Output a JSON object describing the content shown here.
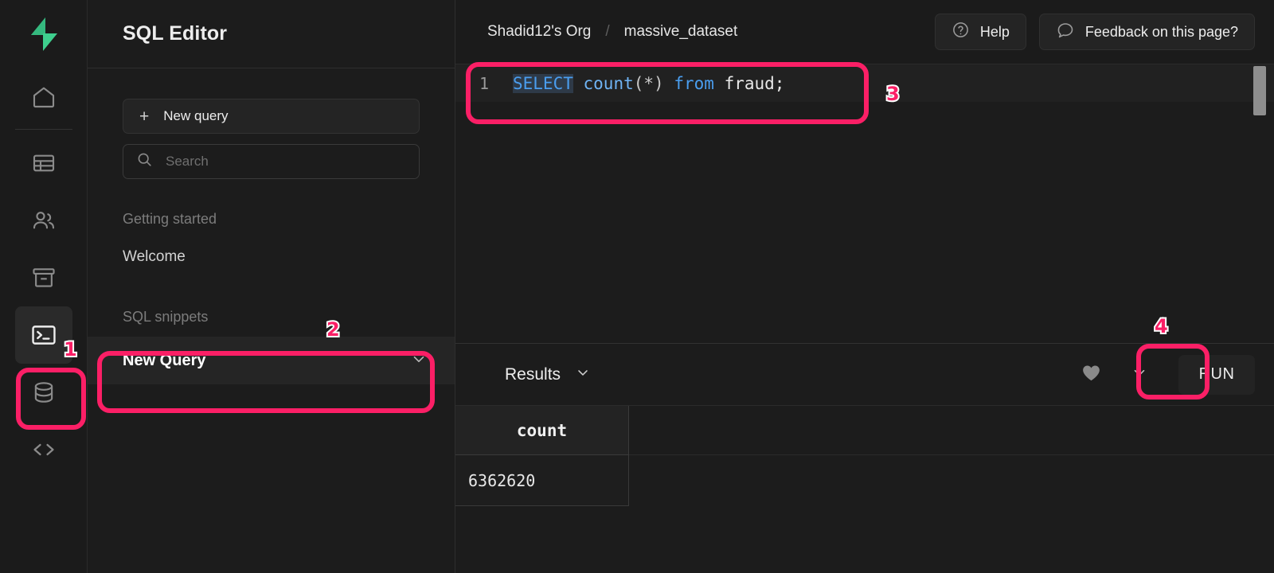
{
  "app": {
    "logo": "supabase-logo"
  },
  "rail": {
    "items": [
      {
        "icon": "home-icon",
        "name": "home",
        "active": false
      },
      {
        "icon": "table-icon",
        "name": "table-editor",
        "active": false
      },
      {
        "icon": "users-icon",
        "name": "authentication",
        "active": false
      },
      {
        "icon": "archive-icon",
        "name": "storage",
        "active": false
      },
      {
        "icon": "terminal-icon",
        "name": "sql-editor",
        "active": true
      },
      {
        "icon": "database-icon",
        "name": "database",
        "active": false
      },
      {
        "icon": "code-icon",
        "name": "api-docs",
        "active": false
      }
    ]
  },
  "panel": {
    "title": "SQL Editor",
    "new_query_label": "New query",
    "search_placeholder": "Search",
    "getting_started_label": "Getting started",
    "welcome_label": "Welcome",
    "snippets_label": "SQL snippets",
    "selected_snippet": "New Query"
  },
  "topbar": {
    "org": "Shadid12's Org",
    "separator": "/",
    "project": "massive_dataset",
    "help_label": "Help",
    "feedback_label": "Feedback on this page?"
  },
  "editor": {
    "line_number": "1",
    "tokens": [
      {
        "text": "SELECT",
        "type": "keyword-selected"
      },
      {
        "text": " ",
        "type": "plain"
      },
      {
        "text": "count",
        "type": "function"
      },
      {
        "text": "(",
        "type": "punct"
      },
      {
        "text": "*",
        "type": "punct"
      },
      {
        "text": ") ",
        "type": "punct"
      },
      {
        "text": "from",
        "type": "keyword"
      },
      {
        "text": " fraud;",
        "type": "plain"
      }
    ],
    "full_query": "SELECT count(*) from fraud;"
  },
  "results": {
    "label": "Results",
    "run_label": "RUN",
    "favorite_icon": "heart-icon",
    "dropdown_icon": "chevron-down-icon",
    "columns": [
      "count"
    ],
    "rows": [
      [
        "6362620"
      ]
    ]
  },
  "annotations": {
    "accent": "#fb1f66",
    "markers": [
      {
        "number": "1",
        "target": "sql-editor-rail-button"
      },
      {
        "number": "2",
        "target": "new-query-snippet"
      },
      {
        "number": "3",
        "target": "sql-code-line"
      },
      {
        "number": "4",
        "target": "run-button"
      }
    ]
  }
}
